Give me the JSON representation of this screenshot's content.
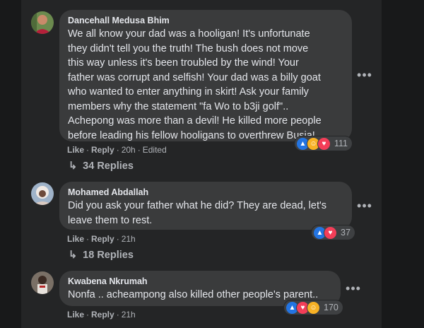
{
  "comments": [
    {
      "author": "Dancehall Medusa Bhim",
      "text": "We all know your dad was a hooligan! It's unfortunate\nthey didn't tell you the truth! The bush does not move\nthis way unless it's been troubled by the wind! Your\nfather was corrupt and selfish! Your dad was a billy goat\nwho wanted to enter anything in skirt! Ask your family\nmembers why the statement \"fa Wo to b3ji golf\"..\nAchepong was more than a devil! He killed more people\nbefore leading his fellow hooligans to overthrew Busia!",
      "like": "Like",
      "reply": "Reply",
      "time": "20h",
      "edited": "Edited",
      "reactions": [
        "like-icon",
        "haha-icon",
        "love-icon"
      ],
      "reaction_count": "111",
      "replies": "34 Replies"
    },
    {
      "author": "Mohamed Abdallah",
      "text": "Did you ask your father what he did? They are dead, let's\nleave them to rest.",
      "like": "Like",
      "reply": "Reply",
      "time": "21h",
      "reactions": [
        "like-icon",
        "love-icon"
      ],
      "reaction_count": "37",
      "replies": "18 Replies"
    },
    {
      "author": "Kwabena Nkrumah",
      "text": "Nonfa .. acheampong also killed other people's parent..",
      "like": "Like",
      "reply": "Reply",
      "time": "21h",
      "reactions": [
        "like-icon",
        "love-icon",
        "haha-icon"
      ],
      "reaction_count": "170"
    }
  ],
  "colors": {
    "background": "#18191a",
    "panel": "#242526",
    "bubble": "#3a3b3c",
    "secondary_text": "#b0b3b8",
    "like_blue": "#2374e1",
    "love_red": "#f33e58",
    "haha_yellow": "#f7b125"
  },
  "more_icon": "•••",
  "reply_arrow": "↳"
}
